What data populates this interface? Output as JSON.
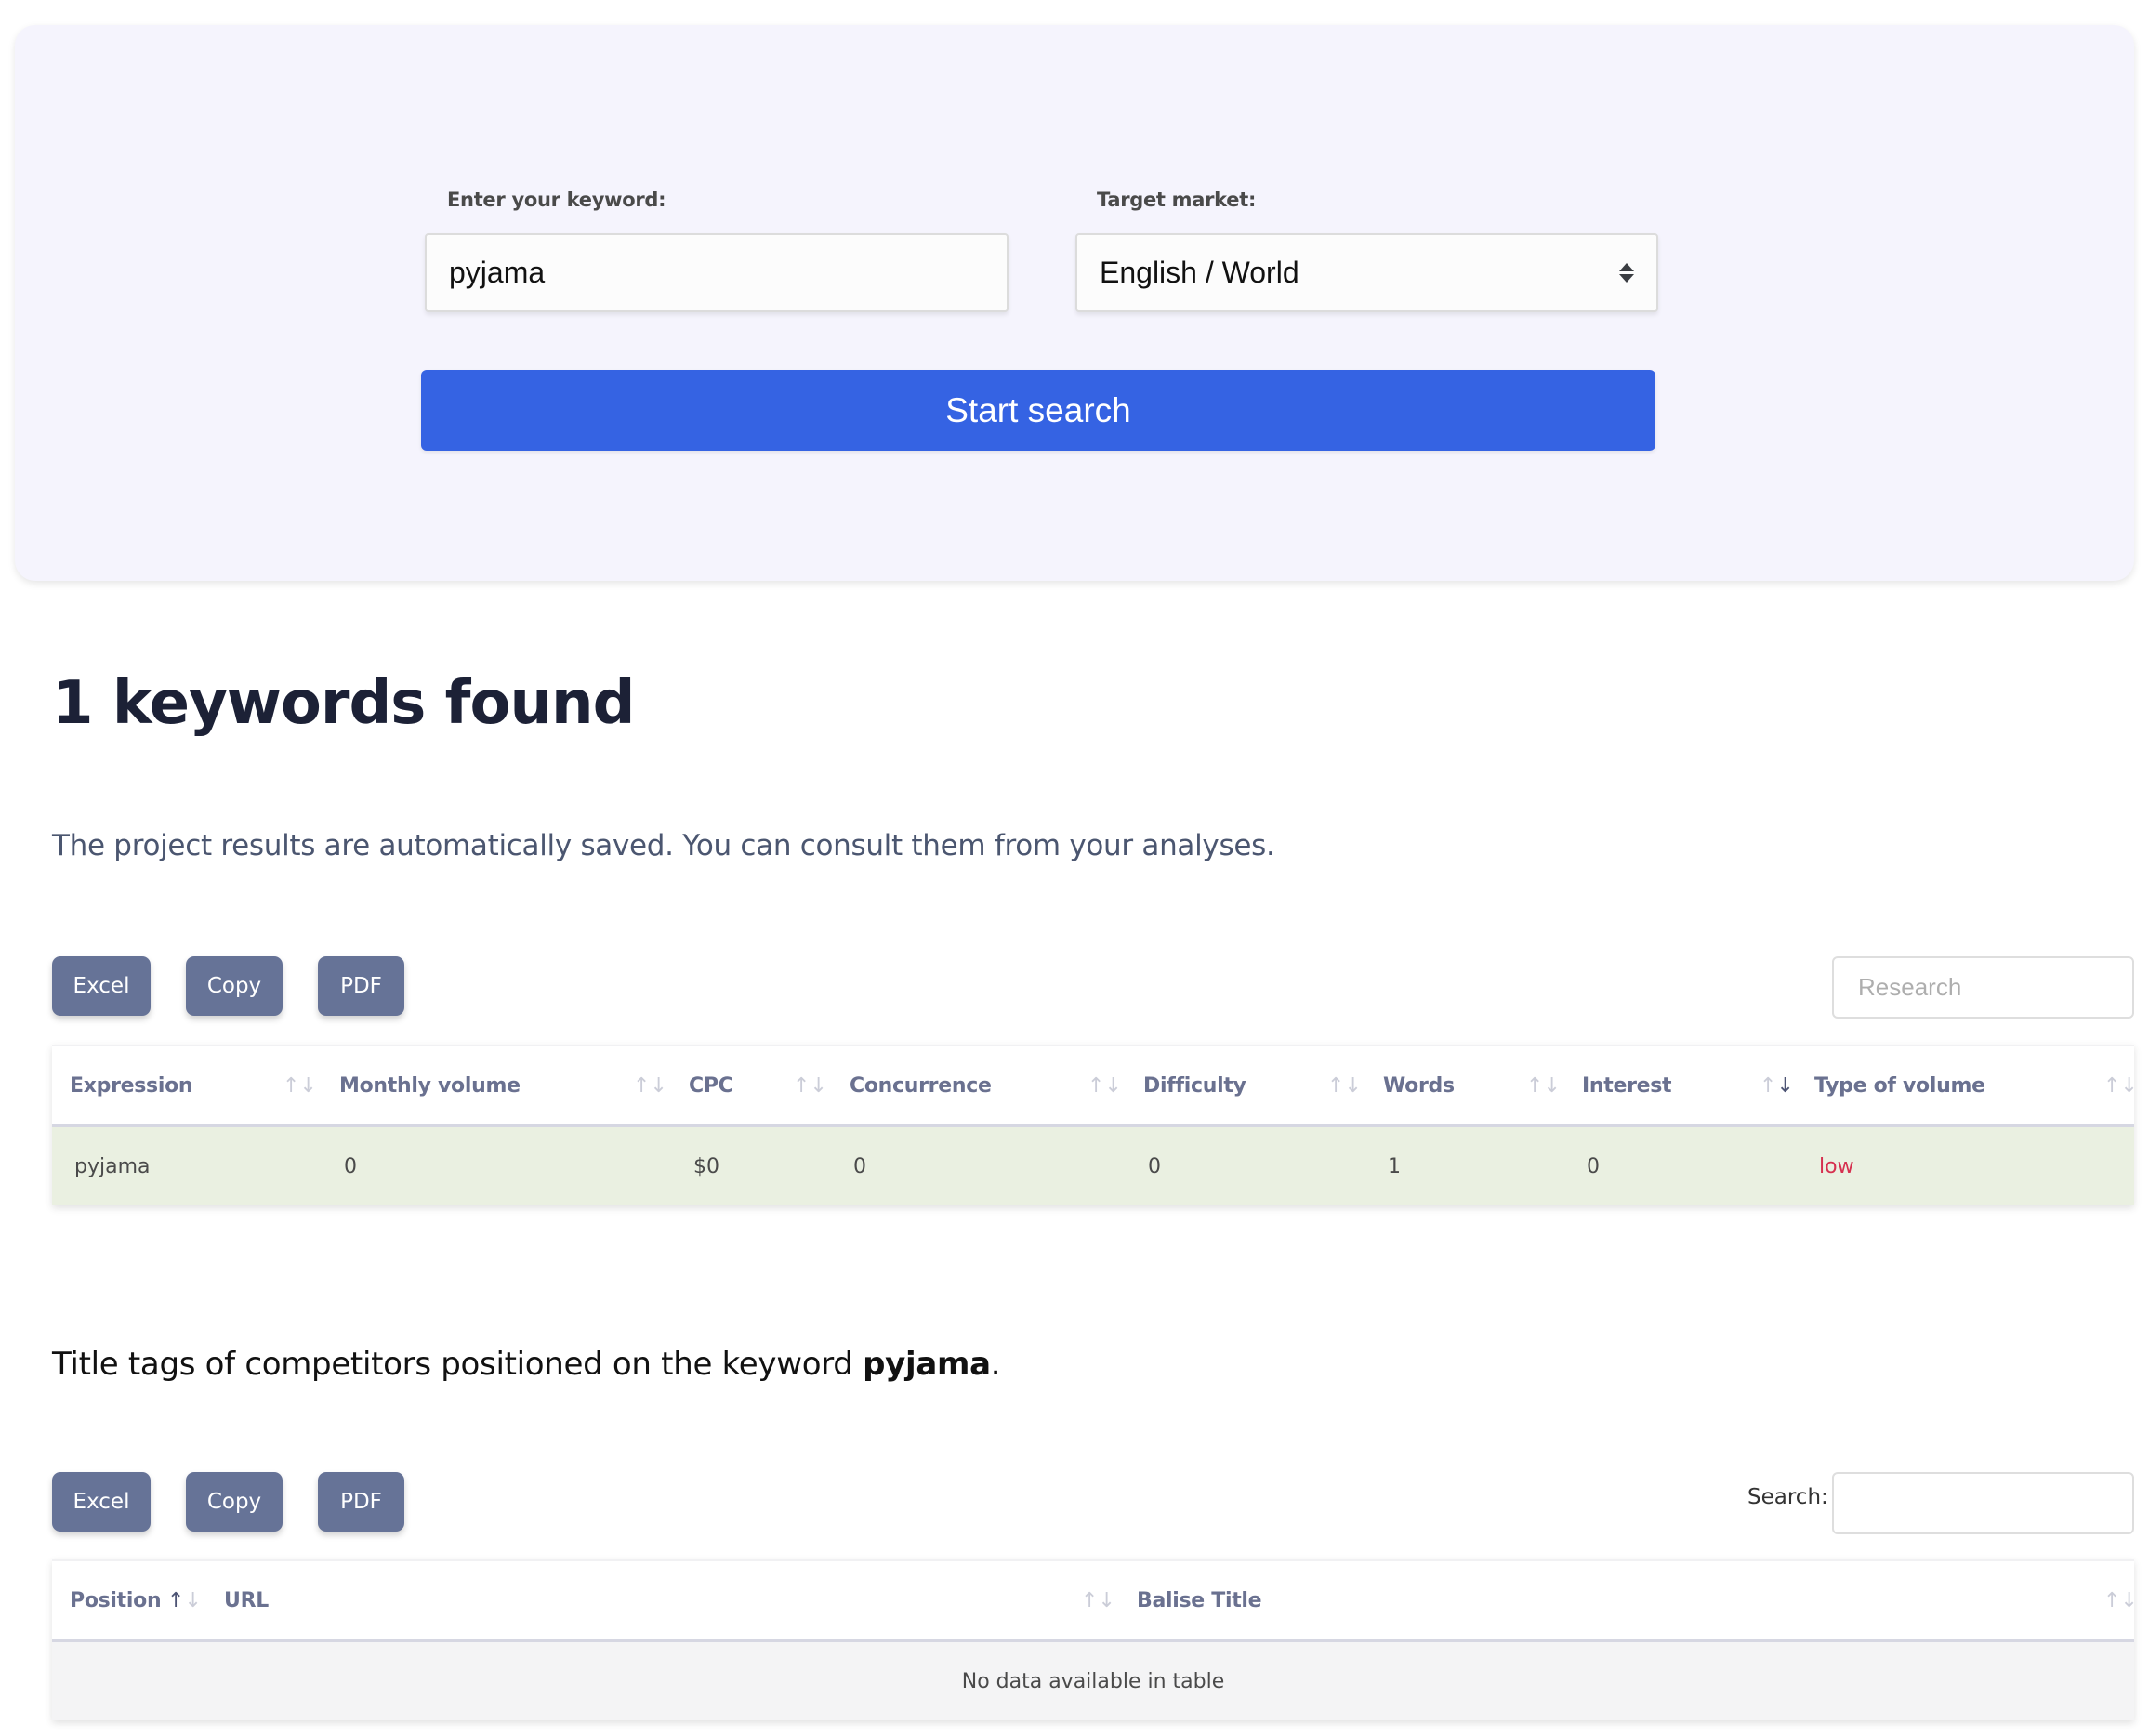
{
  "search_form": {
    "keyword_label": "Enter your keyword:",
    "keyword_value": "pyjama",
    "market_label": "Target market:",
    "market_selected": "English / World",
    "submit_label": "Start search",
    "accent_color": "#3563e3"
  },
  "results": {
    "title": "1 keywords found",
    "note": "The project results are automatically saved. You can consult them from your analyses."
  },
  "keywords_table": {
    "toolbar": {
      "excel": "Excel",
      "copy": "Copy",
      "pdf": "PDF"
    },
    "search_placeholder": "Research",
    "columns": [
      {
        "label": "Expression",
        "sort": "none"
      },
      {
        "label": "Monthly volume",
        "sort": "none"
      },
      {
        "label": "CPC",
        "sort": "none"
      },
      {
        "label": "Concurrence",
        "sort": "none"
      },
      {
        "label": "Difficulty",
        "sort": "none"
      },
      {
        "label": "Words",
        "sort": "none"
      },
      {
        "label": "Interest",
        "sort": "descending"
      },
      {
        "label": "Type of volume",
        "sort": "none"
      }
    ],
    "rows": [
      {
        "expression": "pyjama",
        "monthly_volume": "0",
        "cpc": "$0",
        "concurrence": "0",
        "difficulty": "0",
        "words": "1",
        "interest": "0",
        "type_of_volume": "low",
        "type_color": "#d6304f"
      }
    ]
  },
  "competitors": {
    "intro_prefix": "Title tags of competitors positioned on the keyword ",
    "intro_keyword": "pyjama",
    "intro_suffix": ".",
    "toolbar": {
      "excel": "Excel",
      "copy": "Copy",
      "pdf": "PDF"
    },
    "search_label": "Search:",
    "search_value": "",
    "columns": [
      {
        "label": "Position",
        "sort": "ascending"
      },
      {
        "label": "URL",
        "sort": "none"
      },
      {
        "label": "Balise Title",
        "sort": "none"
      }
    ],
    "empty_message": "No data available in table"
  },
  "icons": {
    "sort": "↑↓",
    "select": "up-down-caret"
  }
}
